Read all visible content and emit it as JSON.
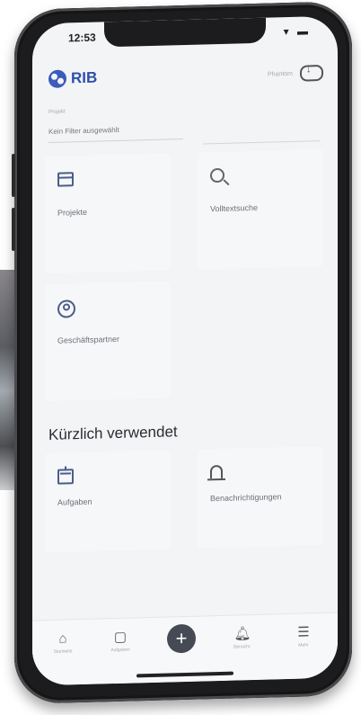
{
  "status": {
    "time": "12:53",
    "icons": "▾ ▬"
  },
  "app": {
    "logo_text": "RIB",
    "brand_color": "#2e4fa8",
    "cloud_label": "Phantom",
    "cloud_icon": "cloud-download-icon"
  },
  "filter": {
    "caption": "Projekt",
    "value": "Kein Filter ausgewählt"
  },
  "tiles": [
    {
      "label": "Projekte",
      "icon": "archive-box-icon"
    },
    {
      "label": "Volltextsuche",
      "icon": "search-icon"
    },
    {
      "label": "Geschäftspartner",
      "icon": "user-circle-icon"
    }
  ],
  "recent": {
    "title": "Kürzlich verwendet",
    "tiles": [
      {
        "label": "Aufgaben",
        "icon": "calendar-icon"
      },
      {
        "label": "Benachrichtigungen",
        "icon": "bell-icon"
      }
    ]
  },
  "tabbar": {
    "items": [
      {
        "label": "Startseite",
        "icon": "⌂"
      },
      {
        "label": "Aufgaben",
        "icon": "▢"
      },
      {
        "label": "Benachr.",
        "icon": "🔔︎"
      },
      {
        "label": "Mehr",
        "icon": "☰"
      }
    ],
    "fab": "+"
  }
}
